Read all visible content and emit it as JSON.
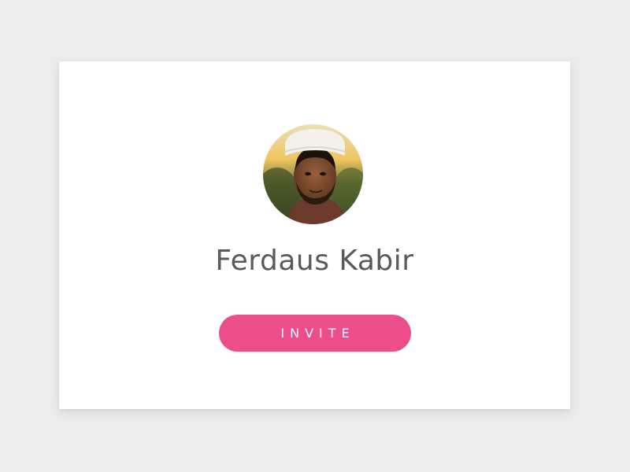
{
  "profile": {
    "name": "Ferdaus Kabir",
    "avatar_icon": "user-photo"
  },
  "actions": {
    "invite_label": "INVITE"
  },
  "colors": {
    "background": "#ececec",
    "card": "#ffffff",
    "accent": "#ec4d8b",
    "name_text": "#5a5a5a"
  }
}
